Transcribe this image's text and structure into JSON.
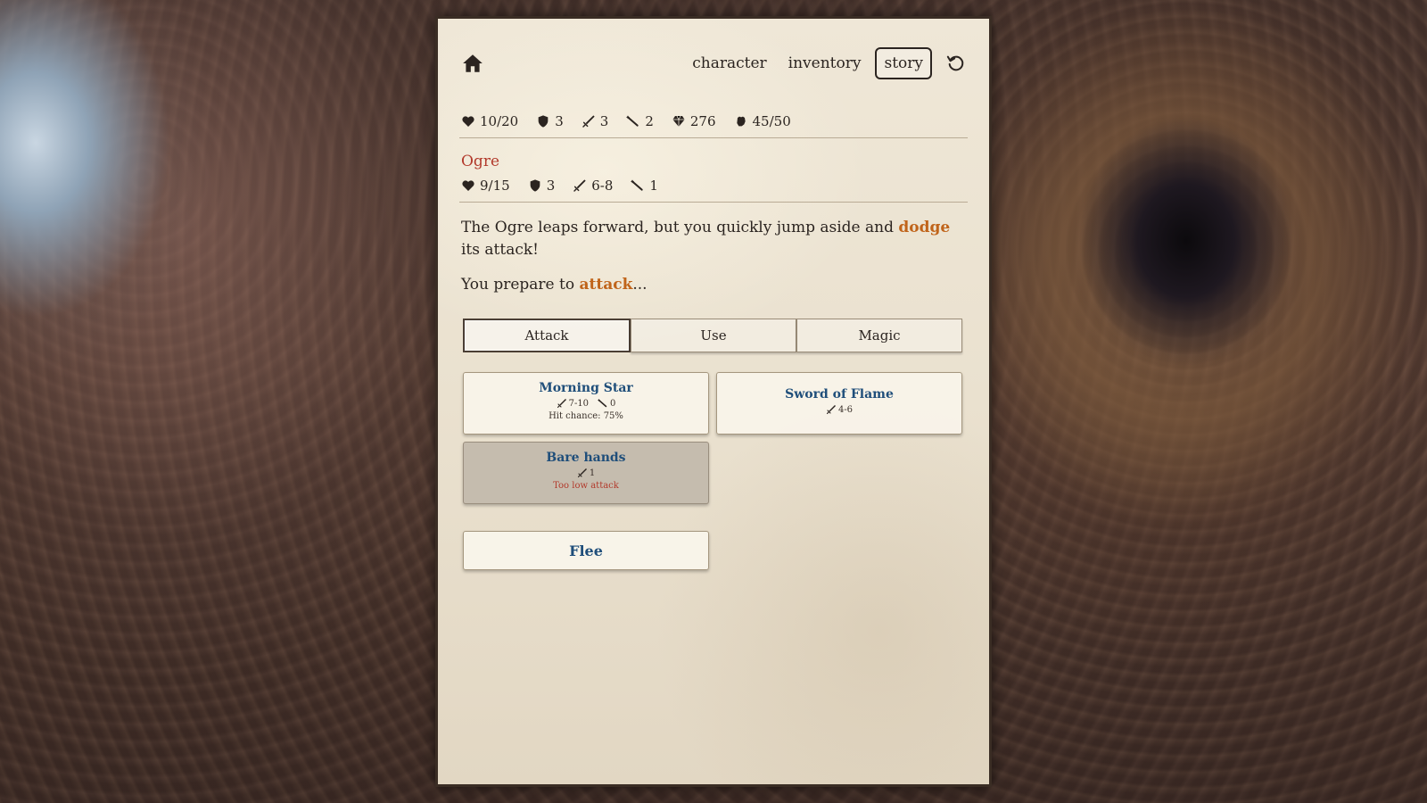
{
  "nav": {
    "links": [
      "character",
      "inventory",
      "story"
    ],
    "active": "story"
  },
  "player_stats": {
    "health": "10/20",
    "armor": "3",
    "attack": "3",
    "magic": "2",
    "gold": "276",
    "experience": "45/50"
  },
  "enemy": {
    "name": "Ogre",
    "health": "9/15",
    "armor": "3",
    "attack": "6-8",
    "magic": "1"
  },
  "narrative": {
    "line1_before": "The Ogre leaps forward, but you quickly jump aside and ",
    "line1_highlight": "dodge",
    "line1_after": " its attack!",
    "line2_before": "You prepare to ",
    "line2_highlight": "attack",
    "line2_after": "..."
  },
  "action_tabs": {
    "attack": "Attack",
    "use": "Use",
    "magic": "Magic"
  },
  "weapons": [
    {
      "name": "Morning Star",
      "attack": "7-10",
      "magic": "0",
      "note": "Hit chance: 75%"
    },
    {
      "name": "Sword of Flame",
      "attack": "4-6"
    },
    {
      "name": "Bare hands",
      "attack": "1",
      "note": "Too low attack"
    }
  ],
  "flee_label": "Flee",
  "colors": {
    "highlight": "#c0641a",
    "enemy_name": "#b23a2c",
    "weapon_name": "#1f4e7a"
  }
}
